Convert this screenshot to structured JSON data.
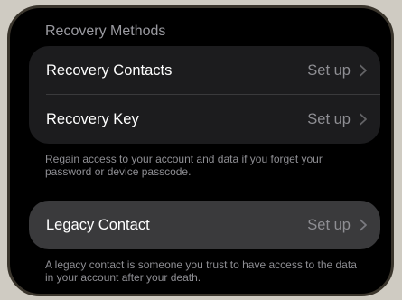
{
  "recovery_methods": {
    "title": "Recovery Methods",
    "rows": [
      {
        "label": "Recovery Contacts",
        "value": "Set up"
      },
      {
        "label": "Recovery Key",
        "value": "Set up"
      }
    ],
    "footnote": "Regain access to your account and data if you forget your password or device passcode."
  },
  "legacy": {
    "rows": [
      {
        "label": "Legacy Contact",
        "value": "Set up"
      }
    ],
    "footnote": "A legacy contact is someone you trust to have access to the data in your account after your death."
  },
  "icons": {
    "row_chevron": "chevron-right-icon"
  }
}
